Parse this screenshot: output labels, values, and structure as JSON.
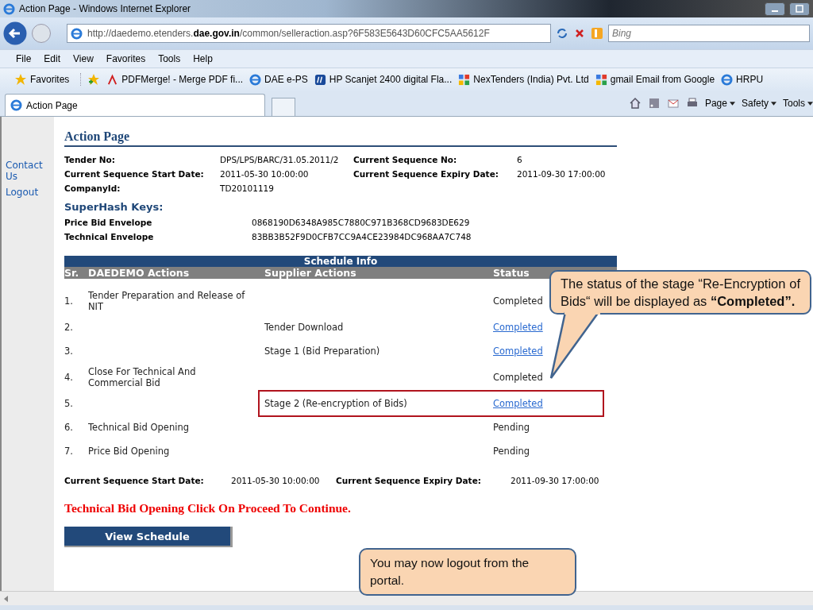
{
  "window": {
    "title": "Action Page - Windows Internet Explorer"
  },
  "address_bar": {
    "url": "http://daedemo.etenders.**dae.gov.in**/common/selleraction.asp?6F583E5643D60CFC5AA5612F",
    "search_placeholder": "Bing"
  },
  "menu": [
    "File",
    "Edit",
    "View",
    "Favorites",
    "Tools",
    "Help"
  ],
  "favorites_bar": {
    "label": "Favorites",
    "items": [
      {
        "label": "PDFMerge! - Merge PDF fi...",
        "kind": "pdf"
      },
      {
        "label": "DAE e-PS",
        "kind": "ie"
      },
      {
        "label": "HP Scanjet 2400 digital Fla...",
        "kind": "hp"
      },
      {
        "label": "NexTenders (India) Pvt. Ltd",
        "kind": "google"
      },
      {
        "label": "gmail Email from Google",
        "kind": "google"
      },
      {
        "label": "HRPU",
        "kind": "ie"
      }
    ]
  },
  "tab": {
    "label": "Action Page"
  },
  "command_bar": [
    "Page",
    "Safety",
    "Tools"
  ],
  "sidebar": [
    "Contact Us",
    "Logout"
  ],
  "page": {
    "heading": "Action Page",
    "details": [
      {
        "label": "Tender No:",
        "value": "DPS/LPS/BARC/31.05.2011/2",
        "label2": "Current Sequence No:",
        "value2": "6"
      },
      {
        "label": "Current Sequence Start Date:",
        "value": "2011-05-30 10:00:00",
        "label2": "Current Sequence Expiry Date:",
        "value2": "2011-09-30 17:00:00"
      },
      {
        "label": "CompanyId:",
        "value": "TD20101119"
      }
    ],
    "hash_title": "SuperHash Keys:",
    "hash_keys": [
      {
        "label": "Price Bid Envelope",
        "value": "0868190D6348A985C7880C971B368CD9683DE629"
      },
      {
        "label": "Technical Envelope",
        "value": "83BB3B52F9D0CFB7CC9A4CE23984DC968AA7C748"
      }
    ],
    "schedule": {
      "title": "Schedule Info",
      "columns": [
        "Sr.",
        "DAEDEMO Actions",
        "Supplier Actions",
        "Status"
      ],
      "rows": [
        {
          "sr": "1.",
          "daedemo_action": "Tender Preparation and Release of NIT",
          "supplier_action": "",
          "status": "Completed",
          "link": false,
          "highlighted": false
        },
        {
          "sr": "2.",
          "daedemo_action": "",
          "supplier_action": "Tender Download",
          "status": "Completed",
          "link": true,
          "highlighted": false
        },
        {
          "sr": "3.",
          "daedemo_action": "",
          "supplier_action": "Stage 1 (Bid Preparation)",
          "status": "Completed",
          "link": true,
          "highlighted": false
        },
        {
          "sr": "4.",
          "daedemo_action": "Close For Technical And Commercial Bid",
          "supplier_action": "",
          "status": "Completed",
          "link": false,
          "highlighted": false
        },
        {
          "sr": "5.",
          "daedemo_action": "",
          "supplier_action": "Stage 2 (Re-encryption of Bids)",
          "status": "Completed",
          "link": true,
          "highlighted": true
        },
        {
          "sr": "6.",
          "daedemo_action": "Technical Bid Opening",
          "supplier_action": "",
          "status": "Pending",
          "link": false,
          "highlighted": false
        },
        {
          "sr": "7.",
          "daedemo_action": "Price Bid Opening",
          "supplier_action": "",
          "status": "Pending",
          "link": false,
          "highlighted": false
        }
      ]
    },
    "footer_dates": [
      {
        "label": "Current Sequence Start Date:",
        "value": "2011-05-30 10:00:00"
      },
      {
        "label": "Current Sequence Expiry Date:",
        "value": "2011-09-30 17:00:00"
      }
    ],
    "notice": "Technical Bid Opening Click On Proceed To Continue.",
    "button": "View Schedule"
  },
  "callouts": [
    {
      "text": "The status of the stage “Re-Encryption of Bids“ will be displayed as **“Completed”.**",
      "kind": "tail"
    },
    {
      "text": "You may now logout from the portal.",
      "kind": "plain"
    }
  ]
}
